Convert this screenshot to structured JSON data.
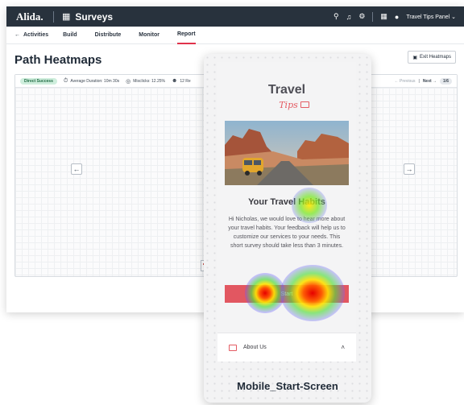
{
  "header": {
    "logo": "Alida.",
    "product": "Surveys",
    "panel": "Travel Tips Panel",
    "icons": [
      "search-icon",
      "bell-icon",
      "gear-icon",
      "apps-grid-icon",
      "user-icon"
    ]
  },
  "subnav": {
    "back_label": "Activities",
    "tabs": [
      {
        "label": "Build",
        "active": false
      },
      {
        "label": "Distribute",
        "active": false
      },
      {
        "label": "Monitor",
        "active": false
      },
      {
        "label": "Report",
        "active": true
      }
    ]
  },
  "page": {
    "title": "Path Heatmaps",
    "exit_label": "Exit Heatmaps"
  },
  "toolbar": {
    "status_badge": "Direct Success",
    "duration": "Average Duration: 10m 30s",
    "misclicks": "Misclicks: 12.25%",
    "respondents": "12 Re",
    "prev_label": "Previous",
    "next_label": "Next",
    "page_indicator": "1/6"
  },
  "phone": {
    "brand_main": "Travel",
    "brand_sub": "Tips",
    "card_title": "Your Travel Habits",
    "card_body": "Hi Nicholas, we would love to hear more about your travel habits. Your feedback will help us to customize our services to your needs. This short survey should  take less than 3 minutes.",
    "start_label": "Start",
    "about_label": "About Us",
    "screen_name": "Mobile_Start-Screen"
  },
  "colors": {
    "topbar": "#28323d",
    "accent": "#e0324b",
    "start_button": "#e25761",
    "badge_bg": "#cfeedd"
  }
}
